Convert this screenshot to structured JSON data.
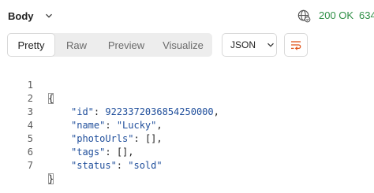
{
  "header": {
    "body_label": "Body",
    "status_code": "200 OK",
    "status_extra": "634"
  },
  "view_tabs": [
    {
      "label": "Pretty",
      "active": true
    },
    {
      "label": "Raw",
      "active": false
    },
    {
      "label": "Preview",
      "active": false
    },
    {
      "label": "Visualize",
      "active": false
    }
  ],
  "format": {
    "selected": "JSON"
  },
  "icons": {
    "body_dropdown": "chevron-down-icon",
    "network": "globe-icon",
    "format_dropdown": "chevron-down-icon",
    "wrap": "wrap-lines-icon"
  },
  "colors": {
    "status_ok": "#2f8f46",
    "json_token": "#1f4e9b",
    "wrap_icon": "#e0541b"
  },
  "code": {
    "line_numbers": [
      "1",
      "2",
      "3",
      "4",
      "5",
      "6",
      "7"
    ],
    "open_brace": "{",
    "close_brace": "}",
    "fields": [
      {
        "key": "\"id\"",
        "sep": ": ",
        "value": "9223372036854250000",
        "type": "num",
        "trail": ","
      },
      {
        "key": "\"name\"",
        "sep": ": ",
        "value": "\"Lucky\"",
        "type": "str",
        "trail": ","
      },
      {
        "key": "\"photoUrls\"",
        "sep": ": ",
        "value": "[]",
        "type": "punc",
        "trail": ","
      },
      {
        "key": "\"tags\"",
        "sep": ": ",
        "value": "[]",
        "type": "punc",
        "trail": ","
      },
      {
        "key": "\"status\"",
        "sep": ": ",
        "value": "\"sold\"",
        "type": "str",
        "trail": ""
      }
    ]
  }
}
